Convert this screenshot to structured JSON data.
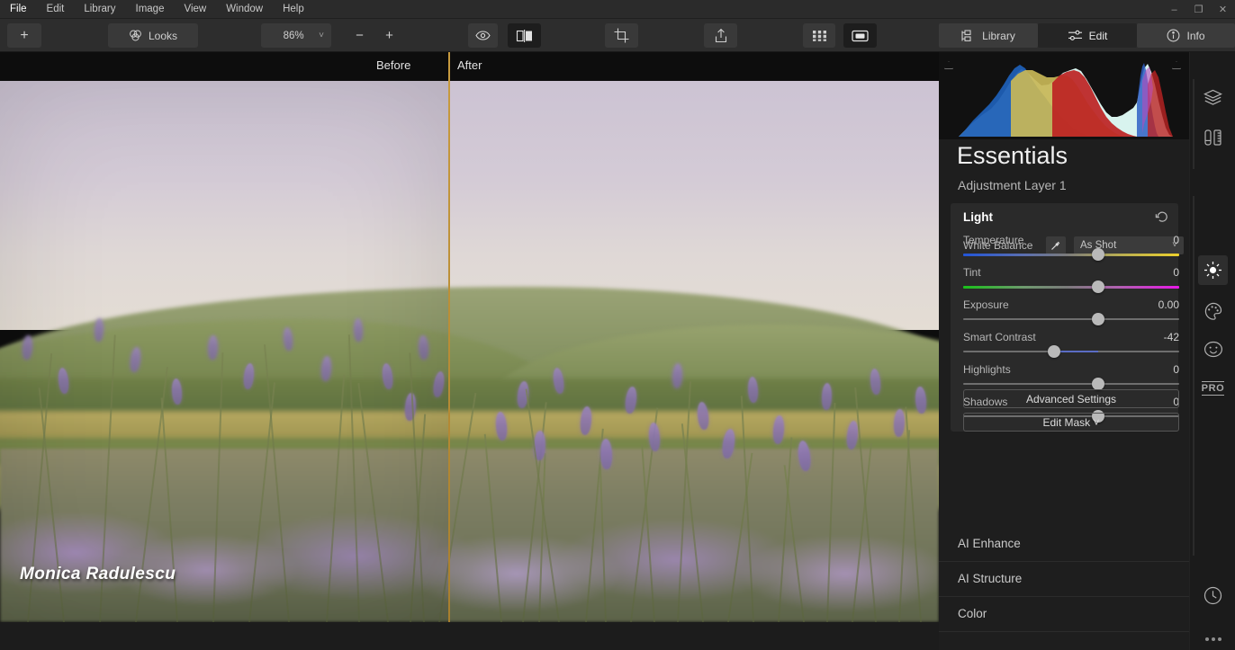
{
  "window": {
    "controls": [
      {
        "name": "minimize",
        "glyph": "–"
      },
      {
        "name": "restore",
        "glyph": "❐"
      },
      {
        "name": "close",
        "glyph": "✕"
      }
    ]
  },
  "menubar": {
    "items": [
      "File",
      "Edit",
      "Library",
      "Image",
      "View",
      "Window",
      "Help"
    ]
  },
  "toolbar": {
    "add_label": "+",
    "looks_label": "Looks",
    "looks_icon": "looks-icon",
    "zoom_value": "86%",
    "zoom_caret": "˅",
    "zoom_out_label": "−",
    "zoom_in_label": "+",
    "eye_icon": "eye-icon",
    "compare_icon": "before-after-compare-icon",
    "crop_icon": "crop-icon",
    "share_icon": "share-icon",
    "grid_icon": "grid-view-icon",
    "single_icon": "single-view-icon"
  },
  "modes": {
    "tabs": [
      {
        "label": "Library",
        "icon": "library-icon",
        "active": false
      },
      {
        "label": "Edit",
        "icon": "sliders-icon",
        "active": true
      },
      {
        "label": "Info",
        "icon": "info-icon",
        "active": false
      }
    ]
  },
  "canvas": {
    "before_label": "Before",
    "after_label": "After",
    "divider_color": "#c79a3e",
    "watermark": "Monica Radulescu"
  },
  "panel": {
    "title": "Essentials",
    "subtitle": "Adjustment Layer 1",
    "histogram": {
      "clip_left_icon": "clipping-warning-icon",
      "clip_right_icon": "clipping-warning-icon"
    },
    "light": {
      "header": "Light",
      "reset_icon": "reset-icon",
      "white_balance_label": "White Balance",
      "eyedropper_icon": "eyedropper-icon",
      "white_balance_value": "As Shot",
      "white_balance_caret": "˅",
      "sliders": [
        {
          "label": "Temperature",
          "value": "0",
          "pos": 62.5,
          "kind": "temp",
          "fill": 0
        },
        {
          "label": "Tint",
          "value": "0",
          "pos": 62.5,
          "kind": "tint",
          "fill": 0
        },
        {
          "label": "Exposure",
          "value": "0.00",
          "pos": 62.5,
          "kind": "plain",
          "fill": 0
        },
        {
          "label": "Smart Contrast",
          "value": "-42",
          "pos": 42.0,
          "kind": "plain",
          "fill": 1
        },
        {
          "label": "Highlights",
          "value": "0",
          "pos": 62.5,
          "kind": "plain",
          "fill": 0
        },
        {
          "label": "Shadows",
          "value": "0",
          "pos": 62.5,
          "kind": "plain",
          "fill": 0
        }
      ],
      "advanced_settings_label": "Advanced Settings",
      "edit_mask_label": "Edit Mask ˅"
    },
    "sections": [
      {
        "label": "AI Enhance"
      },
      {
        "label": "AI Structure"
      },
      {
        "label": "Color"
      }
    ]
  },
  "rail": {
    "items": [
      {
        "name": "layers-icon",
        "label": "Layers",
        "active": false
      },
      {
        "name": "tools-icon",
        "label": "Tools",
        "active": false
      },
      {
        "name": "essentials-icon",
        "label": "Essentials",
        "active": true
      },
      {
        "name": "creative-icon",
        "label": "Creative",
        "active": false
      },
      {
        "name": "portrait-icon",
        "label": "Portrait",
        "active": false
      },
      {
        "name": "pro-icon",
        "label": "PRO",
        "active": false
      },
      {
        "name": "history-icon",
        "label": "History",
        "active": false
      },
      {
        "name": "more-icon",
        "label": "More",
        "active": false
      }
    ]
  },
  "colors": {
    "accent": "#c79a3e",
    "slider_fill": "#5b6cc4",
    "panel_bg": "#1e1e1e",
    "card_bg": "#2a2a2a"
  }
}
